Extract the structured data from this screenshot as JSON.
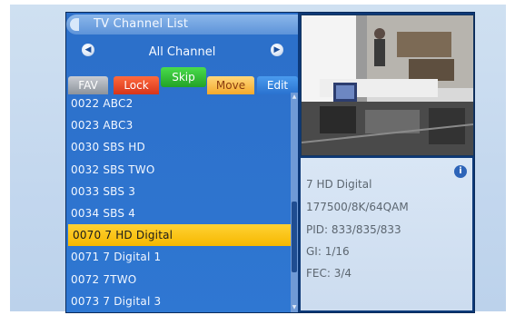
{
  "window": {
    "title": "TV Channel List"
  },
  "group": {
    "label": "All Channel",
    "left_icon": "left-arrow-icon",
    "right_icon": "right-arrow-icon"
  },
  "buttons": {
    "fav": "FAV",
    "lock": "Lock",
    "skip": "Skip",
    "move": "Move",
    "edit": "Edit"
  },
  "channels": [
    {
      "label": "0022  ABC2",
      "selected": false
    },
    {
      "label": "0023  ABC3",
      "selected": false
    },
    {
      "label": "0030  SBS HD",
      "selected": false
    },
    {
      "label": "0032  SBS TWO",
      "selected": false
    },
    {
      "label": "0033  SBS 3",
      "selected": false
    },
    {
      "label": "0034  SBS 4",
      "selected": false
    },
    {
      "label": "0070  7 HD Digital",
      "selected": true
    },
    {
      "label": "0071  7 Digital 1",
      "selected": false
    },
    {
      "label": "0072  7TWO",
      "selected": false
    },
    {
      "label": "0073  7 Digital 3",
      "selected": false
    }
  ],
  "info": {
    "name": "7 HD Digital",
    "tuning": "177500/8K/64QAM",
    "pid": "PID: 833/835/833",
    "gi": "GI: 1/16",
    "fec": "FEC: 3/4",
    "icon": "info-icon"
  },
  "colors": {
    "selected_row": "#f6b800",
    "panel_bg": "#2f77d2",
    "fav": "#8d939b",
    "lock": "#d6351a",
    "skip": "#23a226",
    "move": "#f4a92c",
    "edit": "#2a72cf"
  }
}
